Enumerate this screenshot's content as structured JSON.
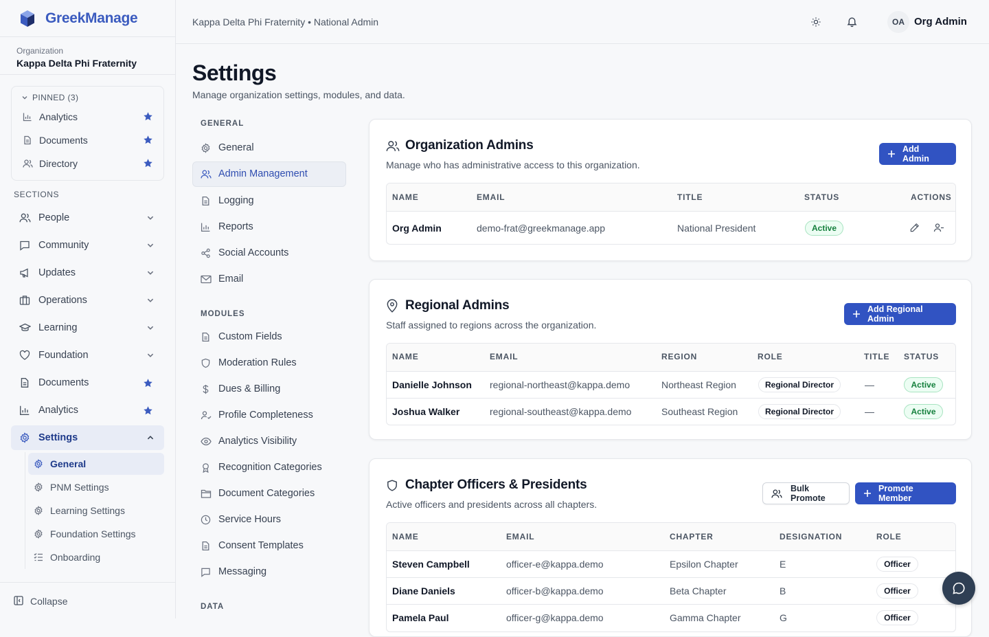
{
  "brand": {
    "name": "GreekManage"
  },
  "org": {
    "label": "Organization",
    "name": "Kappa Delta Phi Fraternity"
  },
  "pinned": {
    "header": "PINNED (3)",
    "items": [
      {
        "label": "Analytics",
        "icon": "bar-chart-icon"
      },
      {
        "label": "Documents",
        "icon": "document-icon"
      },
      {
        "label": "Directory",
        "icon": "users-icon"
      }
    ]
  },
  "sections_label": "SECTIONS",
  "nav": [
    {
      "label": "People",
      "icon": "users-icon"
    },
    {
      "label": "Community",
      "icon": "message-icon"
    },
    {
      "label": "Updates",
      "icon": "megaphone-icon"
    },
    {
      "label": "Operations",
      "icon": "briefcase-icon"
    },
    {
      "label": "Learning",
      "icon": "graduation-cap-icon"
    },
    {
      "label": "Foundation",
      "icon": "heart-icon"
    },
    {
      "label": "Documents",
      "icon": "document-icon"
    },
    {
      "label": "Analytics",
      "icon": "bar-chart-icon"
    },
    {
      "label": "Settings",
      "icon": "gear-icon"
    }
  ],
  "settings_sub": [
    {
      "label": "General",
      "icon": "gear-icon"
    },
    {
      "label": "PNM Settings",
      "icon": "gear-icon"
    },
    {
      "label": "Learning Settings",
      "icon": "gear-icon"
    },
    {
      "label": "Foundation Settings",
      "icon": "gear-icon"
    },
    {
      "label": "Onboarding",
      "icon": "list-checks-icon"
    }
  ],
  "collapse_label": "Collapse",
  "topbar": {
    "breadcrumb": "Kappa Delta Phi Fraternity • National Admin",
    "avatar": "OA",
    "user": "Org Admin"
  },
  "page": {
    "title": "Settings",
    "subtitle": "Manage organization settings, modules, and data."
  },
  "settings_nav": {
    "general_label": "GENERAL",
    "general": [
      "General",
      "Admin Management",
      "Logging",
      "Reports",
      "Social Accounts",
      "Email"
    ],
    "modules_label": "MODULES",
    "modules": [
      "Custom Fields",
      "Moderation Rules",
      "Dues & Billing",
      "Profile Completeness",
      "Analytics Visibility",
      "Recognition Categories",
      "Document Categories",
      "Service Hours",
      "Consent Templates",
      "Messaging"
    ],
    "data_label": "DATA"
  },
  "org_admins": {
    "title": "Organization Admins",
    "desc": "Manage who has administrative access to this organization.",
    "button": "Add Admin",
    "columns": [
      "NAME",
      "EMAIL",
      "TITLE",
      "STATUS",
      "ACTIONS"
    ],
    "rows": [
      {
        "name": "Org Admin",
        "email": "demo-frat@greekmanage.app",
        "title": "National President",
        "status": "Active"
      }
    ]
  },
  "regional_admins": {
    "title": "Regional Admins",
    "desc": "Staff assigned to regions across the organization.",
    "button": "Add Regional Admin",
    "columns": [
      "NAME",
      "EMAIL",
      "REGION",
      "ROLE",
      "TITLE",
      "STATUS"
    ],
    "rows": [
      {
        "name": "Danielle Johnson",
        "email": "regional-northeast@kappa.demo",
        "region": "Northeast Region",
        "role": "Regional Director",
        "title": "—",
        "status": "Active"
      },
      {
        "name": "Joshua Walker",
        "email": "regional-southeast@kappa.demo",
        "region": "Southeast Region",
        "role": "Regional Director",
        "title": "—",
        "status": "Active"
      }
    ]
  },
  "officers": {
    "title": "Chapter Officers & Presidents",
    "desc": "Active officers and presidents across all chapters.",
    "bulk_button": "Bulk Promote",
    "button": "Promote Member",
    "columns": [
      "NAME",
      "EMAIL",
      "CHAPTER",
      "DESIGNATION",
      "ROLE"
    ],
    "rows": [
      {
        "name": "Steven Campbell",
        "email": "officer-e@kappa.demo",
        "chapter": "Epsilon Chapter",
        "designation": "E",
        "role": "Officer"
      },
      {
        "name": "Diane Daniels",
        "email": "officer-b@kappa.demo",
        "chapter": "Beta Chapter",
        "designation": "B",
        "role": "Officer"
      },
      {
        "name": "Pamela Paul",
        "email": "officer-g@kappa.demo",
        "chapter": "Gamma Chapter",
        "designation": "G",
        "role": "Officer"
      }
    ]
  }
}
